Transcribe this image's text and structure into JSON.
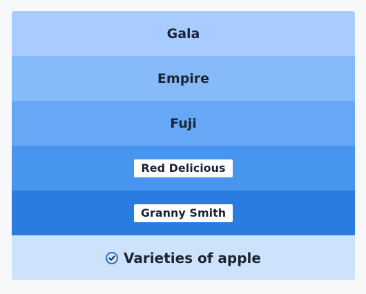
{
  "list": {
    "items": [
      {
        "label": "Gala",
        "style": "plain"
      },
      {
        "label": "Empire",
        "style": "plain"
      },
      {
        "label": "Fuji",
        "style": "plain"
      },
      {
        "label": "Red Delicious",
        "style": "pill"
      },
      {
        "label": "Granny Smith",
        "style": "pill"
      }
    ],
    "footer": {
      "label": "Varieties of apple",
      "icon": "check-circle-icon"
    }
  },
  "colors": {
    "row_shades": [
      "#a8ccff",
      "#86baf9",
      "#66a8f6",
      "#4795ef",
      "#2a7cde"
    ],
    "footer_bg": "#cde3fb",
    "accent": "#2a6fc9"
  }
}
